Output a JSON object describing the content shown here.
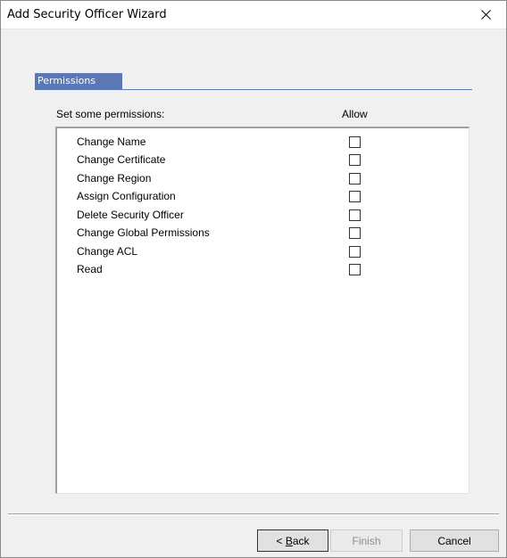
{
  "window": {
    "title": "Add Security Officer Wizard"
  },
  "tab": {
    "label": "Permissions"
  },
  "permissions": {
    "set_label": "Set some permissions:",
    "allow_header": "Allow",
    "items": [
      {
        "label": "Change Name",
        "allowed": false
      },
      {
        "label": "Change Certificate",
        "allowed": false
      },
      {
        "label": "Change Region",
        "allowed": false
      },
      {
        "label": "Assign Configuration",
        "allowed": false
      },
      {
        "label": "Delete Security Officer",
        "allowed": false
      },
      {
        "label": "Change Global Permissions",
        "allowed": false
      },
      {
        "label": "Change ACL",
        "allowed": false
      },
      {
        "label": "Read",
        "allowed": false
      }
    ]
  },
  "buttons": {
    "back_prefix": "< ",
    "back_mnemonic": "B",
    "back_rest": "ack",
    "finish": "Finish",
    "cancel": "Cancel"
  },
  "colors": {
    "tab_accent": "#5b78b5"
  }
}
